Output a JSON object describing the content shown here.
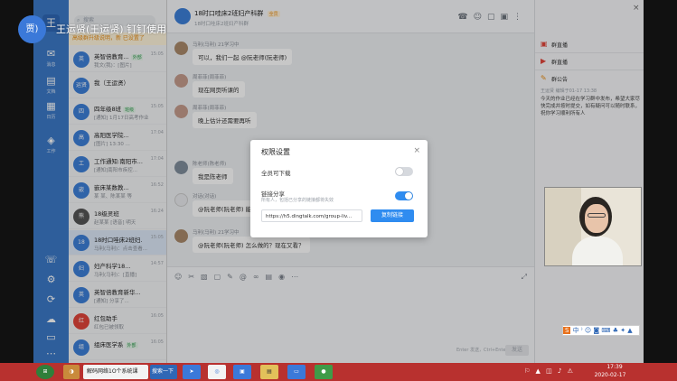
{
  "overlay": {
    "avatar_text": "贾)",
    "title": "王运贤(王运贤) 钉钉使用"
  },
  "sidebar": {
    "items": [
      {
        "icon": "chat-icon",
        "label": "消息"
      },
      {
        "icon": "doc-icon",
        "label": "文档"
      },
      {
        "icon": "calendar-icon",
        "label": "日历"
      },
      {
        "icon": "work-icon",
        "label": "工作"
      },
      {
        "icon": "contacts-icon",
        "label": "通讯录"
      }
    ]
  },
  "chatlist": {
    "search_placeholder": "搜索",
    "notice": "高级群升级说明，新 已设置了",
    "items": [
      {
        "title": "英智倍教育...",
        "tag": "外部",
        "preview": "我文(我)：[图片]",
        "time": "15:05",
        "avatar": "英",
        "color": "#3d7fd8"
      },
      {
        "title": "我（王运贤）",
        "tag": "",
        "preview": "",
        "time": "",
        "avatar": "运贤",
        "color": "#3d7fd8"
      },
      {
        "title": "四年级8班",
        "tag": "班级",
        "preview": "[通知] 1月17日高考作业",
        "time": "15:05",
        "avatar": "四",
        "color": "#3d7fd8"
      },
      {
        "title": "高阳医学院...",
        "tag": "",
        "preview": "[图片] 13:30 ...",
        "time": "17:04",
        "avatar": "高",
        "color": "#3d7fd8"
      },
      {
        "title": "工作通知:南阳市...",
        "tag": "",
        "preview": "[通知]南阳市疾控...",
        "time": "17:04",
        "avatar": "工",
        "color": "#3d7fd8"
      },
      {
        "title": "嵌床某数教...",
        "tag": "",
        "preview": "某 某、陈某某 等",
        "time": "16:52",
        "avatar": "嵌",
        "color": "#3d7fd8"
      },
      {
        "title": "18级灵班",
        "tag": "",
        "preview": "赵某某 [语音] 明天",
        "time": "16:24",
        "avatar": "熊",
        "color": "#555"
      },
      {
        "title": "18时口哇床2班妇...",
        "tag": "",
        "preview": "马利(马利)：点击查看...",
        "time": "15:05",
        "avatar": "18",
        "color": "#3d7fd8"
      },
      {
        "title": "妇产科学18...",
        "tag": "",
        "preview": "马利(马利)：[直播]",
        "time": "14:57",
        "avatar": "妇",
        "color": "#3d7fd8"
      },
      {
        "title": "英智倍教育新华...",
        "tag": "",
        "preview": "[通知] 分享了...",
        "time": "",
        "avatar": "英",
        "color": "#3d7fd8"
      },
      {
        "title": "红包助手",
        "tag": "",
        "preview": "红包已被领取",
        "time": "16:05",
        "avatar": "红",
        "color": "#e0453a"
      },
      {
        "title": "组床医学系",
        "tag": "外部",
        "preview": "",
        "time": "16:05",
        "avatar": "组",
        "color": "#3d7fd8"
      }
    ]
  },
  "chat": {
    "title": "18时口哇床2班妇产科群",
    "title_tag": "全员",
    "subtitle": "18时口哇床2班妇产科群",
    "messages": [
      {
        "name": "马利(马利)   21学习中",
        "text": "可以，我们一起 @阮老师(阮老师)",
        "avatar_color": "#a98a6b"
      },
      {
        "name": "周菲菲(周菲菲)",
        "text": "现在网页听课的",
        "avatar_color": "#c49b8c"
      },
      {
        "name": "周菲菲(周菲菲)",
        "text": "晚上估计还需要再听",
        "avatar_color": "#c49b8c"
      },
      {
        "name": "陈老师(陈老师)",
        "text": "我是陈老师",
        "avatar_color": "#7f8d9c"
      },
      {
        "name": "对话(对话)",
        "text": "@阮老师(阮老师) 能收到吗 能收到",
        "avatar_color": "#e8eaee"
      },
      {
        "name": "马利(马利)   21学习中",
        "text": "@阮老师(阮老师) 怎么做的？现在又看？",
        "avatar_color": "#a98a6b"
      }
    ],
    "input_hint": "Enter 发送，Ctrl+Enter 换行",
    "send_label": "发送"
  },
  "right_panel": {
    "items": [
      {
        "icon": "live-icon",
        "label": "群直播"
      },
      {
        "icon": "record-icon",
        "label": "群直播"
      },
      {
        "icon": "notice-icon",
        "label": "群公告"
      }
    ],
    "announcement_meta": "王运贤  编辑于01-17 13:38",
    "announcement_text": "今天的作业已经在学习群中发布，希望大家尽快完成并按时提交，如有疑问可以随时联系，祝你学习顺利所有人"
  },
  "dialog": {
    "title": "权限设置",
    "option1": "全员可下载",
    "option2_title": "链接分享",
    "option2_desc": "所有人，包括已分享的链接都将失效",
    "link_value": "https://h5.dingtalk.com/group-liv...",
    "copy_button": "复制链接",
    "colors": {
      "accent": "#2f8cf0",
      "toggle_off": "#d6d9de"
    }
  },
  "taskbar": {
    "app1": "解码网络1O个系统课",
    "app2": "搜索一下",
    "time": "17:39",
    "date": "2020-02-17"
  }
}
